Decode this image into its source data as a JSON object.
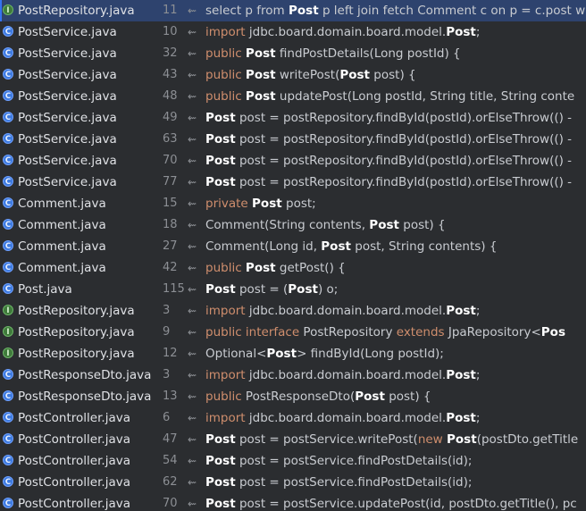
{
  "colors": {
    "background": "#2b2d30",
    "selection": "#2e436e",
    "keyword": "#cf8e6d",
    "highlight": "#ffffff",
    "line_number": "#8c8f94",
    "class_icon": "#3d7ae0",
    "interface_icon": "#3f7a3b"
  },
  "results": [
    {
      "file": "PostRepository.java",
      "line": "11",
      "kind": "interface",
      "icon": "interface-file-icon",
      "selected": true,
      "code": [
        {
          "t": "select p from ",
          "s": "pl"
        },
        {
          "t": "Post",
          "s": "hl"
        },
        {
          "t": " p left join fetch Comment c on p = c.post w",
          "s": "pl"
        }
      ]
    },
    {
      "file": "PostService.java",
      "line": "10",
      "kind": "class",
      "icon": "class-file-icon",
      "code": [
        {
          "t": "import ",
          "s": "kw"
        },
        {
          "t": "jdbc.board.domain.board.model.",
          "s": "pl"
        },
        {
          "t": "Post",
          "s": "hl"
        },
        {
          "t": ";",
          "s": "pl"
        }
      ]
    },
    {
      "file": "PostService.java",
      "line": "32",
      "kind": "class",
      "icon": "class-file-icon",
      "code": [
        {
          "t": "public ",
          "s": "kw"
        },
        {
          "t": "Post",
          "s": "hl"
        },
        {
          "t": " findPostDetails(Long postId) {",
          "s": "pl"
        }
      ]
    },
    {
      "file": "PostService.java",
      "line": "43",
      "kind": "class",
      "icon": "class-file-icon",
      "code": [
        {
          "t": "public ",
          "s": "kw"
        },
        {
          "t": "Post",
          "s": "hl"
        },
        {
          "t": " writePost(",
          "s": "pl"
        },
        {
          "t": "Post",
          "s": "hl"
        },
        {
          "t": " post) {",
          "s": "pl"
        }
      ]
    },
    {
      "file": "PostService.java",
      "line": "48",
      "kind": "class",
      "icon": "class-file-icon",
      "code": [
        {
          "t": "public ",
          "s": "kw"
        },
        {
          "t": "Post",
          "s": "hl"
        },
        {
          "t": " updatePost(Long postId, String title, String conte",
          "s": "pl"
        }
      ]
    },
    {
      "file": "PostService.java",
      "line": "49",
      "kind": "class",
      "icon": "class-file-icon",
      "code": [
        {
          "t": "Post",
          "s": "hl"
        },
        {
          "t": " post = postRepository.findById(postId).orElseThrow(() -",
          "s": "pl"
        }
      ]
    },
    {
      "file": "PostService.java",
      "line": "63",
      "kind": "class",
      "icon": "class-file-icon",
      "code": [
        {
          "t": "Post",
          "s": "hl"
        },
        {
          "t": " post = postRepository.findById(postId).orElseThrow(() -",
          "s": "pl"
        }
      ]
    },
    {
      "file": "PostService.java",
      "line": "70",
      "kind": "class",
      "icon": "class-file-icon",
      "code": [
        {
          "t": "Post",
          "s": "hl"
        },
        {
          "t": " post = postRepository.findById(postId).orElseThrow(() -",
          "s": "pl"
        }
      ]
    },
    {
      "file": "PostService.java",
      "line": "77",
      "kind": "class",
      "icon": "class-file-icon",
      "code": [
        {
          "t": "Post",
          "s": "hl"
        },
        {
          "t": " post = postRepository.findById(postId).orElseThrow(() -",
          "s": "pl"
        }
      ]
    },
    {
      "file": "Comment.java",
      "line": "15",
      "kind": "class",
      "icon": "class-file-icon",
      "code": [
        {
          "t": "private ",
          "s": "kw"
        },
        {
          "t": "Post",
          "s": "hl"
        },
        {
          "t": " post;",
          "s": "pl"
        }
      ]
    },
    {
      "file": "Comment.java",
      "line": "18",
      "kind": "class",
      "icon": "class-file-icon",
      "code": [
        {
          "t": "Comment(String contents, ",
          "s": "pl"
        },
        {
          "t": "Post",
          "s": "hl"
        },
        {
          "t": " post) {",
          "s": "pl"
        }
      ]
    },
    {
      "file": "Comment.java",
      "line": "27",
      "kind": "class",
      "icon": "class-file-icon",
      "code": [
        {
          "t": "Comment(Long id, ",
          "s": "pl"
        },
        {
          "t": "Post",
          "s": "hl"
        },
        {
          "t": " post, String contents) {",
          "s": "pl"
        }
      ]
    },
    {
      "file": "Comment.java",
      "line": "42",
      "kind": "class",
      "icon": "class-file-icon",
      "code": [
        {
          "t": "public ",
          "s": "kw"
        },
        {
          "t": "Post",
          "s": "hl"
        },
        {
          "t": " getPost() {",
          "s": "pl"
        }
      ]
    },
    {
      "file": "Post.java",
      "line": "115",
      "kind": "class",
      "icon": "class-file-icon",
      "code": [
        {
          "t": "Post",
          "s": "hl"
        },
        {
          "t": " post = (",
          "s": "pl"
        },
        {
          "t": "Post",
          "s": "hl"
        },
        {
          "t": ") o;",
          "s": "pl"
        }
      ]
    },
    {
      "file": "PostRepository.java",
      "line": "3",
      "kind": "interface",
      "icon": "interface-file-icon",
      "code": [
        {
          "t": "import ",
          "s": "kw"
        },
        {
          "t": "jdbc.board.domain.board.model.",
          "s": "pl"
        },
        {
          "t": "Post",
          "s": "hl"
        },
        {
          "t": ";",
          "s": "pl"
        }
      ]
    },
    {
      "file": "PostRepository.java",
      "line": "9",
      "kind": "interface",
      "icon": "interface-file-icon",
      "code": [
        {
          "t": "public interface ",
          "s": "kw"
        },
        {
          "t": "PostRepository ",
          "s": "pl"
        },
        {
          "t": "extends ",
          "s": "kw"
        },
        {
          "t": "JpaRepository<",
          "s": "pl"
        },
        {
          "t": "Pos",
          "s": "hl"
        }
      ]
    },
    {
      "file": "PostRepository.java",
      "line": "12",
      "kind": "interface",
      "icon": "interface-file-icon",
      "code": [
        {
          "t": "Optional<",
          "s": "pl"
        },
        {
          "t": "Post",
          "s": "hl"
        },
        {
          "t": "> findById(Long postId);",
          "s": "pl"
        }
      ]
    },
    {
      "file": "PostResponseDto.java",
      "line": "3",
      "kind": "class",
      "icon": "class-file-icon",
      "code": [
        {
          "t": "import ",
          "s": "kw"
        },
        {
          "t": "jdbc.board.domain.board.model.",
          "s": "pl"
        },
        {
          "t": "Post",
          "s": "hl"
        },
        {
          "t": ";",
          "s": "pl"
        }
      ]
    },
    {
      "file": "PostResponseDto.java",
      "line": "13",
      "kind": "class",
      "icon": "class-file-icon",
      "code": [
        {
          "t": "public ",
          "s": "kw"
        },
        {
          "t": "PostResponseDto(",
          "s": "pl"
        },
        {
          "t": "Post",
          "s": "hl"
        },
        {
          "t": " post) {",
          "s": "pl"
        }
      ]
    },
    {
      "file": "PostController.java",
      "line": "6",
      "kind": "class",
      "icon": "class-file-icon",
      "code": [
        {
          "t": "import ",
          "s": "kw"
        },
        {
          "t": "jdbc.board.domain.board.model.",
          "s": "pl"
        },
        {
          "t": "Post",
          "s": "hl"
        },
        {
          "t": ";",
          "s": "pl"
        }
      ]
    },
    {
      "file": "PostController.java",
      "line": "47",
      "kind": "class",
      "icon": "class-file-icon",
      "code": [
        {
          "t": "Post",
          "s": "hl"
        },
        {
          "t": " post = postService.writePost(",
          "s": "pl"
        },
        {
          "t": "new ",
          "s": "kw"
        },
        {
          "t": "Post",
          "s": "hl"
        },
        {
          "t": "(postDto.getTitle",
          "s": "pl"
        }
      ]
    },
    {
      "file": "PostController.java",
      "line": "54",
      "kind": "class",
      "icon": "class-file-icon",
      "code": [
        {
          "t": "Post",
          "s": "hl"
        },
        {
          "t": " post = postService.findPostDetails(id);",
          "s": "pl"
        }
      ]
    },
    {
      "file": "PostController.java",
      "line": "62",
      "kind": "class",
      "icon": "class-file-icon",
      "code": [
        {
          "t": "Post",
          "s": "hl"
        },
        {
          "t": " post = postService.findPostDetails(id);",
          "s": "pl"
        }
      ]
    },
    {
      "file": "PostController.java",
      "line": "70",
      "kind": "class",
      "icon": "class-file-icon",
      "code": [
        {
          "t": "Post",
          "s": "hl"
        },
        {
          "t": " post = postService.updatePost(id, postDto.getTitle(), pc",
          "s": "pl"
        }
      ]
    }
  ]
}
